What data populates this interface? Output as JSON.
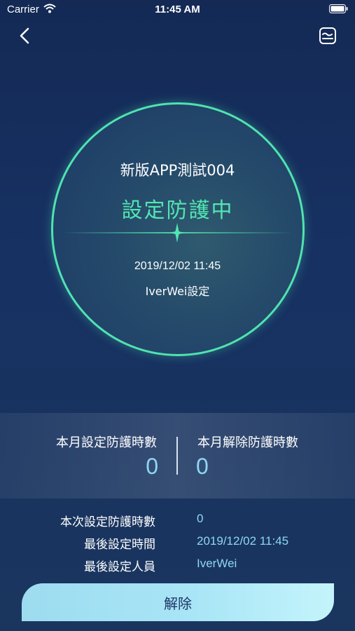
{
  "status_bar": {
    "carrier": "Carrier",
    "time": "11:45 AM"
  },
  "nav": {
    "back_icon": "chevron-left-icon",
    "chart_icon": "chart-icon"
  },
  "device": {
    "name": "新版APP測試004",
    "status": "設定防護中",
    "set_time": "2019/12/02 11:45",
    "set_by": "IverWei設定"
  },
  "stats": {
    "month_set_label": "本月設定防護時數",
    "month_set_value": "0",
    "month_release_label": "本月解除防護時數",
    "month_release_value": "0"
  },
  "info": [
    {
      "label": "本次設定防護時數",
      "value": "0"
    },
    {
      "label": "最後設定時間",
      "value": "2019/12/02 11:45"
    },
    {
      "label": "最後設定人員",
      "value": "IverWei"
    }
  ],
  "action": {
    "release_label": "解除"
  },
  "colors": {
    "accent": "#52e6b2",
    "value_blue": "#8fd6f5",
    "button_bg": "#a8e5f6"
  }
}
